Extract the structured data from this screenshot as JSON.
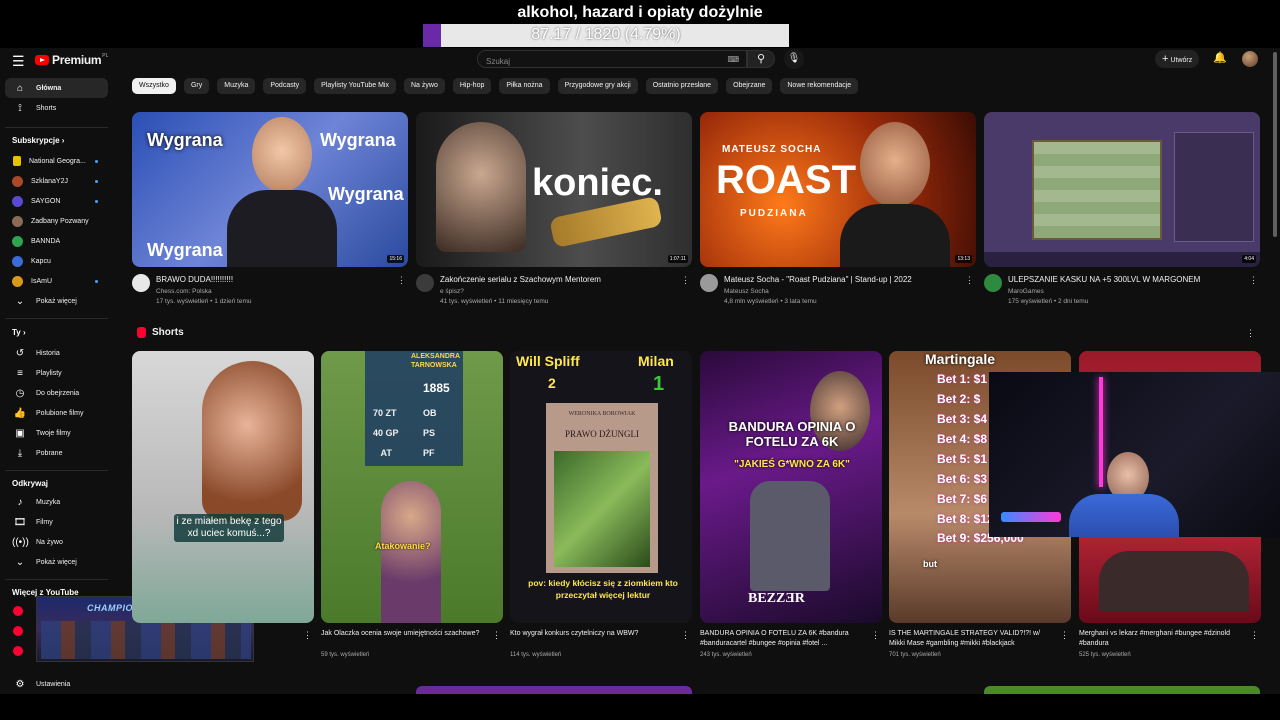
{
  "overlay": {
    "title": "alkohol, hazard i opiaty dożylnie",
    "progress_text": "87.17 / 1820 (4.79%)",
    "progress_fraction": 0.0479
  },
  "header": {
    "logo_text": "Premium",
    "logo_country": "PL",
    "search_placeholder": "Szukaj",
    "create_label": "Utwórz"
  },
  "sidebar": {
    "main": [
      {
        "label": "Główna",
        "icon": "home-icon"
      },
      {
        "label": "Shorts",
        "icon": "shorts-icon"
      }
    ],
    "subscriptions_header": "Subskrypcje",
    "subscriptions": [
      {
        "label": "National Geogra...",
        "color": "#e6c200",
        "dot": true
      },
      {
        "label": "SzklanaY2J",
        "color": "#a84a2a",
        "dot": true
      },
      {
        "label": "SAYGON",
        "color": "#5a4ad1",
        "dot": true
      },
      {
        "label": "Zadbany Pozwany",
        "color": "#8a6b55",
        "dot": false
      },
      {
        "label": "BANNDA",
        "color": "#2fa34f",
        "dot": false
      },
      {
        "label": "Kapcu",
        "color": "#3b6bd6",
        "dot": false
      },
      {
        "label": "IsAmU",
        "color": "#d89a1c",
        "dot": true
      }
    ],
    "show_more": "Pokaż więcej",
    "you_header": "Ty",
    "you_items": [
      {
        "label": "Historia",
        "icon": "history-icon"
      },
      {
        "label": "Playlisty",
        "icon": "playlist-icon"
      },
      {
        "label": "Do obejrzenia",
        "icon": "watch-later-icon"
      },
      {
        "label": "Polubione filmy",
        "icon": "like-icon"
      },
      {
        "label": "Twoje filmy",
        "icon": "your-videos-icon"
      },
      {
        "label": "Pobrane",
        "icon": "download-icon"
      }
    ],
    "explore_header": "Odkrywaj",
    "explore_items": [
      {
        "label": "Muzyka",
        "icon": "music-icon"
      },
      {
        "label": "Filmy",
        "icon": "film-icon"
      },
      {
        "label": "Na żywo",
        "icon": "live-icon"
      },
      {
        "label": "Pokaż więcej",
        "icon": "chevron-down-icon"
      }
    ],
    "more_header": "Więcej z YouTube",
    "settings_label": "Ustawienia"
  },
  "chips": [
    "Wszystko",
    "Gry",
    "Muzyka",
    "Podcasty",
    "Playlisty YouTube Mix",
    "Na żywo",
    "Hip-hop",
    "Piłka nożna",
    "Przygodowe gry akcji",
    "Ostatnio przesłane",
    "Obejrzane",
    "Nowe rekomendacje"
  ],
  "videos": [
    {
      "title": "BRAWO DUDA!!!!!!!!!!",
      "channel": "Chess.com: Polska",
      "meta": "17 tys. wyświetleń • 1 dzień temu",
      "duration": "15:16",
      "thumb_text": "Wygrana"
    },
    {
      "title": "Zakończenie serialu z Szachowym Mentorem",
      "channel": "e śpisz?",
      "meta": "41 tys. wyświetleń • 11 miesięcy temu",
      "duration": "1:07:11",
      "thumb_text": "koniec."
    },
    {
      "title": "Mateusz Socha - \"Roast Pudziana\" | Stand-up | 2022",
      "channel": "Mateusz Socha",
      "meta": "4,8 mln wyświetleń • 3 lata temu",
      "duration": "13:13",
      "thumb_top": "MATEUSZ SOCHA",
      "thumb_text": "ROAST",
      "thumb_sub": "PUDZIANA"
    },
    {
      "title": "ULEPSZANIE KASKU NA +5 300LVL W MARGONEM",
      "channel": "MaroGames",
      "meta": "175 wyświetleń • 2 dni temu",
      "duration": "4:04"
    }
  ],
  "shorts_header": "Shorts",
  "shorts": [
    {
      "title": "",
      "views": "",
      "caption": "i ze miałem bekę z tego xd uciec komuś...?"
    },
    {
      "title": "Jak Olaczka ocenia swoje umiejętności szachowe?",
      "views": "59 tys. wyświetleń",
      "name1": "ALEKSANDRA",
      "name2": "TARNOWSKA",
      "rating": "1885",
      "caption": "Atakowanie?"
    },
    {
      "title": "Kto wygrał konkurs czytelniczy na WBW?",
      "views": "114 tys. wyświetleń",
      "left_name": "Will Spliff",
      "right_name": "Milan",
      "left_score": "2",
      "right_score": "1",
      "book_author": "WERONIKA BOROWIAK",
      "book_title": "PRAWO DŻUNGLI",
      "caption": "pov: kiedy kłócisz się z ziomkiem kto przeczytał więcej lektur"
    },
    {
      "title": "BANDURA OPINIA O FOTELU ZA 6K #bandura #banduracartel #bungee #opinia #fotel ...",
      "views": "243 tys. wyświetleń",
      "caption": "BANDURA OPINIA O FOTELU ZA 6K",
      "caption2": "\"JAKIEŚ G*WNO ZA 6K\""
    },
    {
      "title": "IS THE MARTINGALE STRATEGY VALID?!?! w/ Mikki Mase #gambling #mikki #blackjack",
      "views": "701 tys. wyświetleń",
      "heading": "Martingale",
      "bet_last": "Bet 9: $256,000",
      "caption": "but"
    },
    {
      "title": "Merghani vs lekarz #merghani #bungee #dzinold #bandura",
      "views": "525 tys. wyświetleń"
    }
  ]
}
